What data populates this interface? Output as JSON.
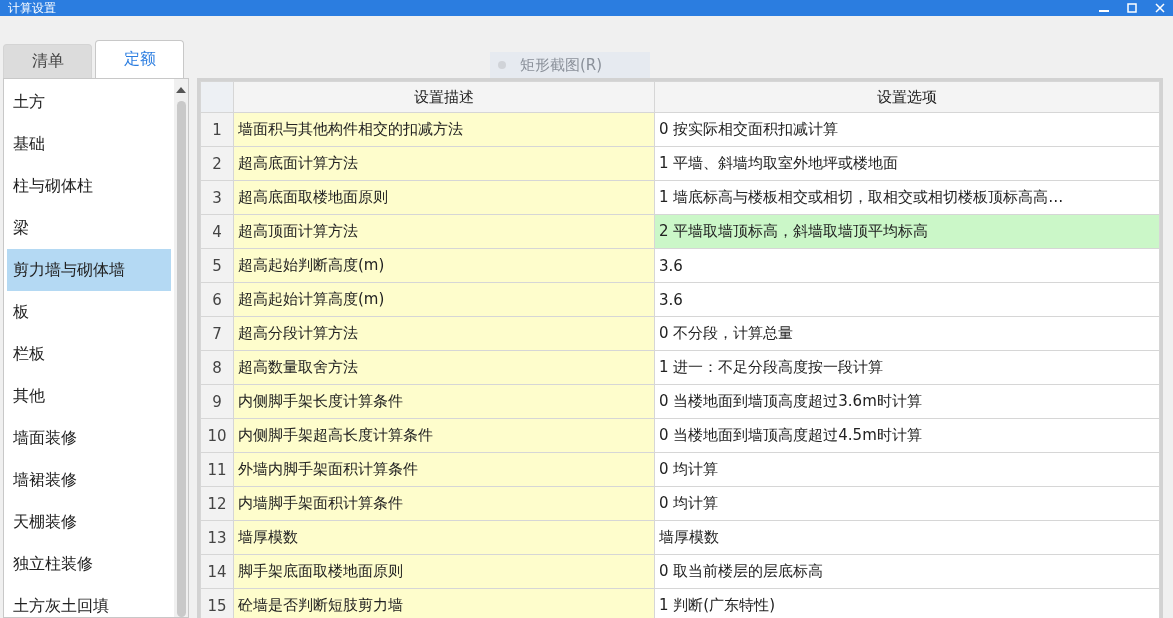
{
  "window": {
    "title": "计算设置"
  },
  "overlay_hint": {
    "label": "矩形截图(R)"
  },
  "tabs": [
    {
      "label": "清单",
      "selected": false
    },
    {
      "label": "定额",
      "selected": true
    }
  ],
  "sidebar": {
    "items": [
      {
        "label": "土方",
        "selected": false
      },
      {
        "label": "基础",
        "selected": false
      },
      {
        "label": "柱与砌体柱",
        "selected": false
      },
      {
        "label": "梁",
        "selected": false
      },
      {
        "label": "剪力墙与砌体墙",
        "selected": true
      },
      {
        "label": "板",
        "selected": false
      },
      {
        "label": "栏板",
        "selected": false
      },
      {
        "label": "其他",
        "selected": false
      },
      {
        "label": "墙面装修",
        "selected": false
      },
      {
        "label": "墙裙装修",
        "selected": false
      },
      {
        "label": "天棚装修",
        "selected": false
      },
      {
        "label": "独立柱装修",
        "selected": false
      },
      {
        "label": "土方灰土回填",
        "selected": false
      }
    ]
  },
  "table": {
    "columns": [
      "设置描述",
      "设置选项"
    ],
    "rows": [
      {
        "index": "1",
        "description": "墙面积与其他构件相交的扣减方法",
        "option": "0 按实际相交面积扣减计算",
        "selected": false
      },
      {
        "index": "2",
        "description": "超高底面计算方法",
        "option": "1 平墙、斜墙均取室外地坪或楼地面",
        "selected": false
      },
      {
        "index": "3",
        "description": "超高底面取楼地面原则",
        "option": "1 墙底标高与楼板相交或相切，取相交或相切楼板顶标高高…",
        "selected": false
      },
      {
        "index": "4",
        "description": "超高顶面计算方法",
        "option": "2 平墙取墙顶标高，斜墙取墙顶平均标高",
        "selected": true
      },
      {
        "index": "5",
        "description": "超高起始判断高度(m)",
        "option": "3.6",
        "selected": false
      },
      {
        "index": "6",
        "description": "超高起始计算高度(m)",
        "option": "3.6",
        "selected": false
      },
      {
        "index": "7",
        "description": "超高分段计算方法",
        "option": "0 不分段，计算总量",
        "selected": false
      },
      {
        "index": "8",
        "description": "超高数量取舍方法",
        "option": "1 进一：不足分段高度按一段计算",
        "selected": false
      },
      {
        "index": "9",
        "description": "内侧脚手架长度计算条件",
        "option": "0 当楼地面到墙顶高度超过3.6m时计算",
        "selected": false
      },
      {
        "index": "10",
        "description": "内侧脚手架超高长度计算条件",
        "option": "0 当楼地面到墙顶高度超过4.5m时计算",
        "selected": false
      },
      {
        "index": "11",
        "description": "外墙内脚手架面积计算条件",
        "option": "0 均计算",
        "selected": false
      },
      {
        "index": "12",
        "description": "内墙脚手架面积计算条件",
        "option": "0 均计算",
        "selected": false
      },
      {
        "index": "13",
        "description": "墙厚模数",
        "option": "墙厚模数",
        "selected": false
      },
      {
        "index": "14",
        "description": "脚手架底面取楼地面原则",
        "option": "0 取当前楼层的层底标高",
        "selected": false
      },
      {
        "index": "15",
        "description": "砼墙是否判断短肢剪力墙",
        "option": "1 判断(广东特性)",
        "selected": false
      }
    ]
  }
}
